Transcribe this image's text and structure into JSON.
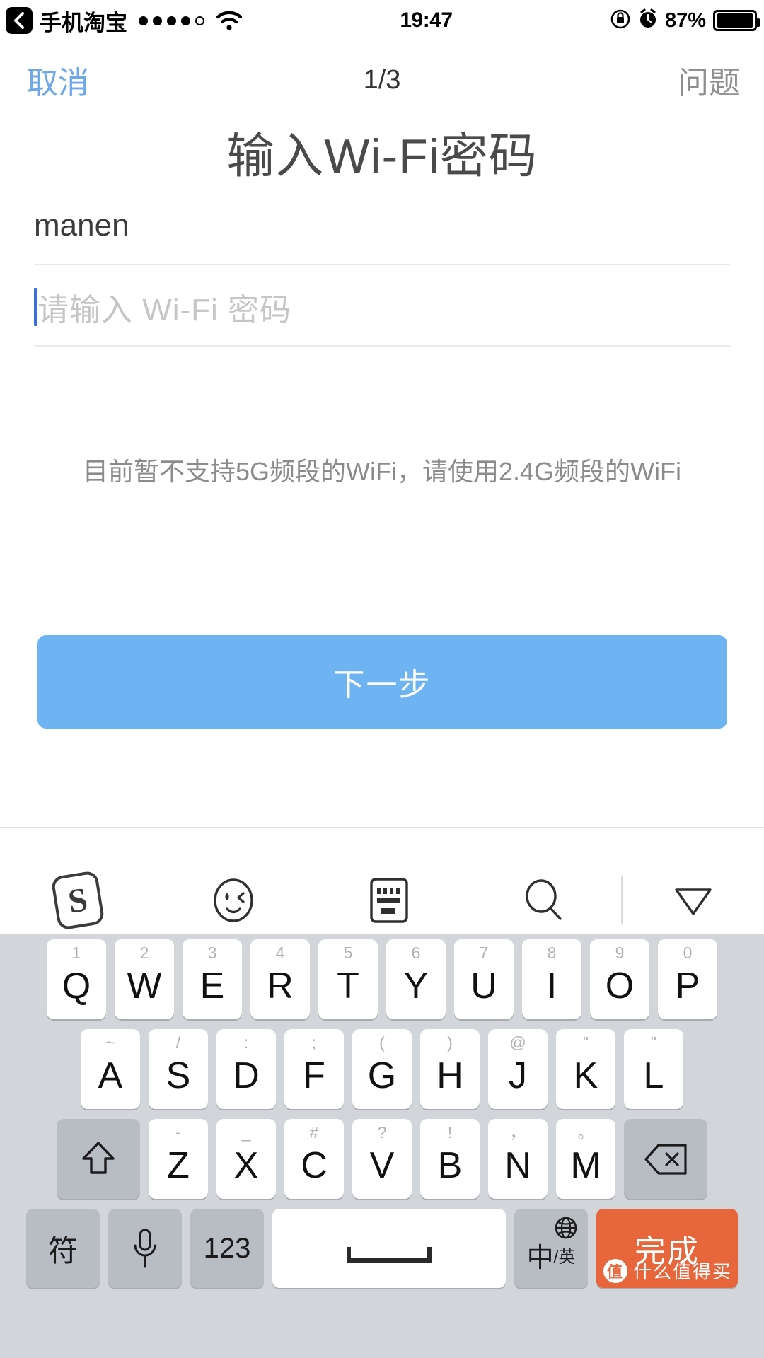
{
  "status_bar": {
    "back_icon": "back-chevron-icon",
    "app_name": "手机淘宝",
    "signal_dots_filled": 4,
    "signal_dots_total": 5,
    "wifi_icon": "wifi-icon",
    "time": "19:47",
    "rotation_lock_icon": "rotation-lock-icon",
    "alarm_icon": "alarm-clock-icon",
    "battery_percent": "87%",
    "battery_icon": "battery-full-icon"
  },
  "nav_bar": {
    "cancel_label": "取消",
    "page_indicator": "1/3",
    "question_label": "问题"
  },
  "content": {
    "title": "输入Wi-Fi密码",
    "ssid_value": "manen",
    "password_value": "",
    "password_placeholder": "请输入 Wi-Fi 密码",
    "hint": "目前暂不支持5G频段的WiFi，请使用2.4G频段的WiFi",
    "next_button": "下一步"
  },
  "colors": {
    "accent_blue": "#6eb3f2",
    "cancel_blue": "#6fa8e8",
    "caret_blue": "#3b6fe0",
    "done_orange": "#e8663c",
    "keyboard_bg": "#d2d5da",
    "fn_key_bg": "#b8bcc3",
    "hint_gray": "#8b8b8b",
    "placeholder_gray": "#c6c6c6"
  },
  "keyboard": {
    "toolbar": [
      {
        "name": "sogou-logo-icon",
        "label": "S"
      },
      {
        "name": "emoji-icon",
        "label": ""
      },
      {
        "name": "keyboard-icon",
        "label": ""
      },
      {
        "name": "search-icon",
        "label": ""
      },
      {
        "name": "collapse-keyboard-icon",
        "label": ""
      }
    ],
    "row1": [
      {
        "sup": "1",
        "main": "Q"
      },
      {
        "sup": "2",
        "main": "W"
      },
      {
        "sup": "3",
        "main": "E"
      },
      {
        "sup": "4",
        "main": "R"
      },
      {
        "sup": "5",
        "main": "T"
      },
      {
        "sup": "6",
        "main": "Y"
      },
      {
        "sup": "7",
        "main": "U"
      },
      {
        "sup": "8",
        "main": "I"
      },
      {
        "sup": "9",
        "main": "O"
      },
      {
        "sup": "0",
        "main": "P"
      }
    ],
    "row2": [
      {
        "sup": "~",
        "main": "A"
      },
      {
        "sup": "/",
        "main": "S"
      },
      {
        "sup": ":",
        "main": "D"
      },
      {
        "sup": ";",
        "main": "F"
      },
      {
        "sup": "(",
        "main": "G"
      },
      {
        "sup": ")",
        "main": "H"
      },
      {
        "sup": "@",
        "main": "J"
      },
      {
        "sup": "\"",
        "main": "K"
      },
      {
        "sup": "\"",
        "main": "L"
      }
    ],
    "row3": [
      {
        "sup": "-",
        "main": "Z"
      },
      {
        "sup": "_",
        "main": "X"
      },
      {
        "sup": "#",
        "main": "C"
      },
      {
        "sup": "?",
        "main": "V"
      },
      {
        "sup": "!",
        "main": "B"
      },
      {
        "sup": "，",
        "main": "N"
      },
      {
        "sup": "。",
        "main": "M"
      }
    ],
    "shift_key": "shift-icon",
    "backspace_key": "backspace-icon",
    "row4": {
      "symbol_label": "符",
      "mic_label": "mic-icon",
      "numbers_label": "123",
      "space_label": "",
      "lang_main": "中",
      "lang_sub": "/英",
      "done_label": "完成"
    }
  },
  "watermark": {
    "badge": "值",
    "text": "什么值得买"
  }
}
